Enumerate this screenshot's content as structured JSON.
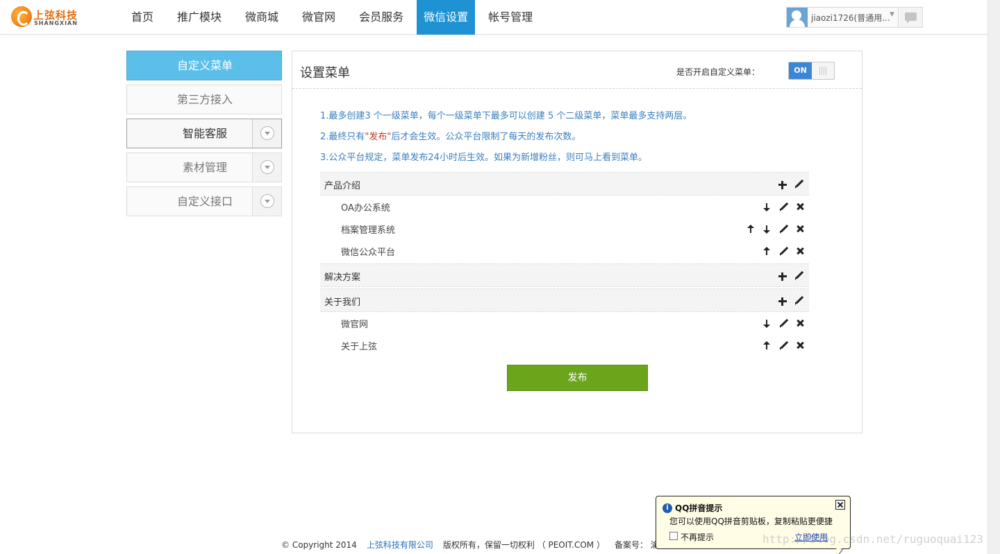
{
  "header": {
    "logo_cn": "上弦科技",
    "logo_en": "SHANGXIAN",
    "nav": [
      {
        "label": "首页",
        "active": false
      },
      {
        "label": "推广模块",
        "active": false
      },
      {
        "label": "微商城",
        "active": false
      },
      {
        "label": "微官网",
        "active": false
      },
      {
        "label": "会员服务",
        "active": false
      },
      {
        "label": "微信设置",
        "active": true
      },
      {
        "label": "帐号管理",
        "active": false
      }
    ],
    "user_name": "jiaozi1726(普通用...",
    "accent_color": "#1e92d3"
  },
  "sidebar": {
    "items": [
      {
        "label": "自定义菜单",
        "state": "active"
      },
      {
        "label": "第三方接入",
        "state": "normal"
      },
      {
        "label": "智能客服",
        "state": "expanded"
      },
      {
        "label": "素材管理",
        "state": "normal"
      },
      {
        "label": "自定义接口",
        "state": "normal"
      }
    ]
  },
  "panel": {
    "title": "设置菜单",
    "toggle_label": "是否开启自定义菜单：",
    "toggle_state": "ON",
    "tips": {
      "tip1": "1.最多创建3 个一级菜单，每个一级菜单下最多可以创建 5 个二级菜单，菜单最多支持两层。",
      "tip2_prefix": "2.最终只有",
      "tip2_highlight": "\"发布\"",
      "tip2_suffix": "后才会生效。公众平台限制了每天的发布次数。",
      "tip3": "3.公众平台规定，菜单发布24小时后生效。如果为新增粉丝，则可马上看到菜单。"
    },
    "menus": [
      {
        "name": "产品介绍",
        "children": [
          "OA办公系统",
          "档案管理系统",
          "微信公众平台"
        ]
      },
      {
        "name": "解决方案",
        "children": []
      },
      {
        "name": "关于我们",
        "children": [
          "微官网",
          "关于上弦"
        ]
      }
    ],
    "publish_label": "发布",
    "publish_color": "#6aa51c"
  },
  "footer": {
    "copyright": "© Copyright 2014",
    "company": "上弦科技有限公司",
    "rights": "版权所有，保留一切权利 （ PEOIT.COM ）",
    "icp": "备案号：   渝IC"
  },
  "qq_popup": {
    "title": "QQ拼音提示",
    "body": "您可以使用QQ拼音剪贴板，复制粘贴更便捷",
    "checkbox_label": "不再提示",
    "link": "立即使用",
    "info_icon": "i"
  },
  "watermark": "http://blog.csdn.net/ruguoquai123"
}
